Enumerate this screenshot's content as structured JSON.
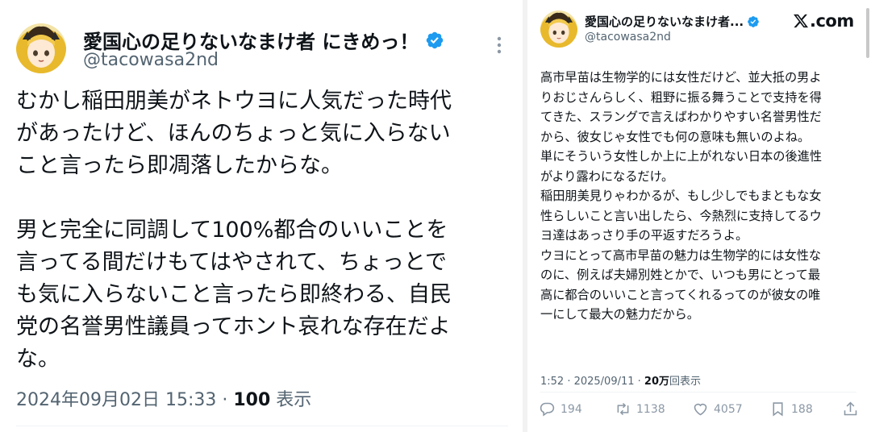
{
  "left_tweet": {
    "display_name": "愛国心の足りないなまけ者 にきめっ！",
    "handle": "@tacowasa2nd",
    "body_lines": [
      "むかし稲田朋美がネトウヨに人気だった時代",
      "があったけど、ほんのちょっと気に入らない",
      "こと言ったら即凋落したからな。",
      "",
      "男と完全に同調して100%都合のいいことを",
      "言ってる間だけもてはやされて、ちょっとで",
      "も気に入らないこと言ったら即終わる、自民",
      "党の名誉男性議員ってホント哀れな存在だよ",
      "な。"
    ],
    "timestamp": "2024年09月02日 15:33 · ",
    "views_count": "100",
    "views_label": " 表示"
  },
  "right_tweet": {
    "display_name": "愛国心の足りないなまけ者...",
    "handle": "@tacowasa2nd",
    "brand": "𝕏.com",
    "brand_text": ".com",
    "body_lines": [
      "高市早苗は生物学的には女性だけど、並大抵の男よ",
      "りおじさんらしく、粗野に振る舞うことで支持を得",
      "てきた、スラングで言えばわかりやすい名誉男性だ",
      "から、彼女じゃ女性でも何の意味も無いのよね。",
      "単にそういう女性しか上に上がれない日本の後進性",
      "がより露わになるだけ。",
      "稲田朋美見りゃわかるが、もし少しでもまともな女",
      "性らしいこと言い出したら、今熱烈に支持してるウ",
      "ヨ達はあっさり手の平返すだろうよ。",
      "ウヨにとって高市早苗の魅力は生物学的には女性な",
      "のに、例えば夫婦別姓とかで、いつも男にとって最",
      "高に都合のいいこと言ってくれるってのが彼女の唯",
      "一にして最大の魅力だから。"
    ],
    "timestamp": "1:52 · 2025/09/11 · ",
    "views_count": "20万",
    "views_label": "回表示",
    "actions": {
      "replies": "194",
      "reposts": "1138",
      "likes": "4057",
      "bookmarks": "188"
    }
  },
  "colors": {
    "verified_blue": "#1d9bf0",
    "text_primary": "#0f1419",
    "text_secondary": "#536471",
    "action_gray": "#8b98a5"
  },
  "icons": [
    "avatar",
    "verified-badge-icon",
    "more-options-icon",
    "x-logo-icon",
    "reply-icon",
    "repost-icon",
    "like-icon",
    "bookmark-icon",
    "share-icon"
  ]
}
